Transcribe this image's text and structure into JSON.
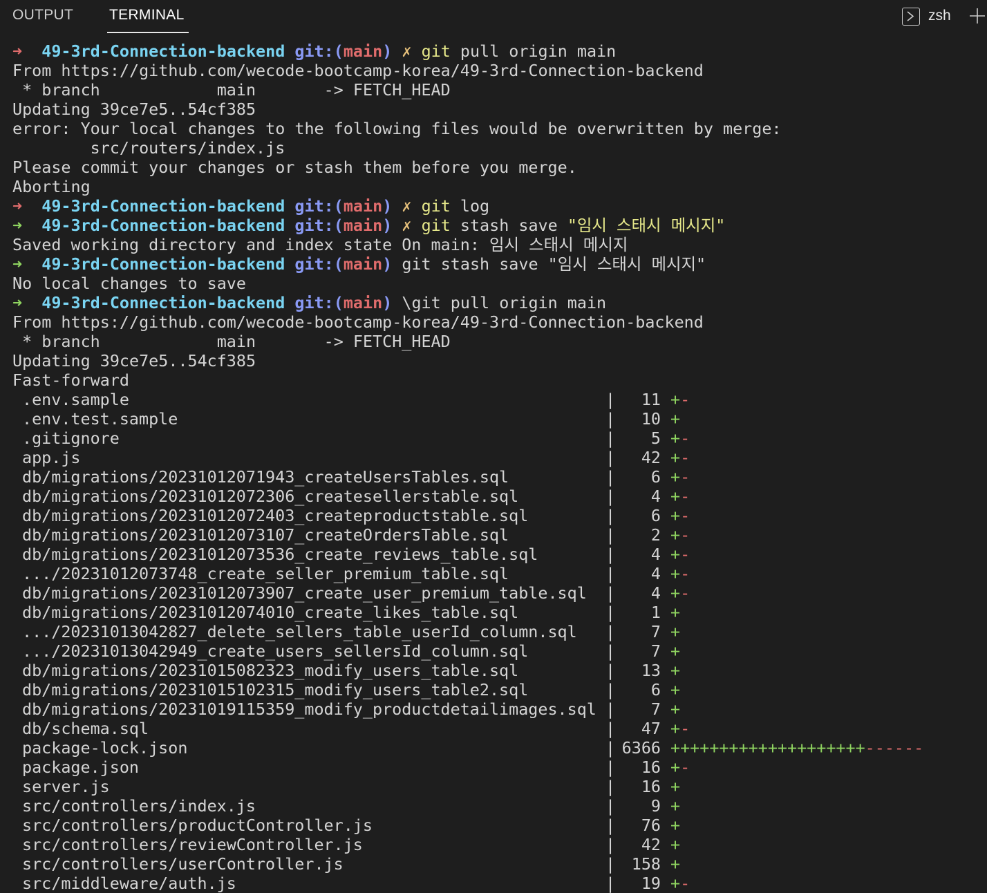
{
  "tabs": {
    "output": "OUTPUT",
    "terminal": "TERMINAL",
    "shell": "zsh"
  },
  "prompt": {
    "dir": "49-3rd-Connection-backend",
    "git": "git:",
    "branch": "main",
    "dirty": "✗"
  },
  "lines": [
    {
      "kind": "prompt",
      "arrow": "red",
      "dirty": true,
      "cmd_hl": "git",
      "cmd_rest": " pull origin main"
    },
    {
      "kind": "text",
      "text": "From https://github.com/wecode-bootcamp-korea/49-3rd-Connection-backend"
    },
    {
      "kind": "text",
      "text": " * branch            main       -> FETCH_HEAD"
    },
    {
      "kind": "text",
      "text": "Updating 39ce7e5..54cf385"
    },
    {
      "kind": "text",
      "text": "error: Your local changes to the following files would be overwritten by merge:"
    },
    {
      "kind": "text",
      "text": "        src/routers/index.js"
    },
    {
      "kind": "text",
      "text": "Please commit your changes or stash them before you merge."
    },
    {
      "kind": "text",
      "text": "Aborting"
    },
    {
      "kind": "prompt",
      "arrow": "red",
      "dirty": true,
      "cmd_hl": "git",
      "cmd_rest": " log"
    },
    {
      "kind": "prompt",
      "arrow": "green",
      "dirty": true,
      "cmd_hl": "git",
      "cmd_rest": " stash save ",
      "cmd_quote": "\"임시 스태시 메시지\""
    },
    {
      "kind": "text",
      "text": "Saved working directory and index state On main: 임시 스태시 메시지"
    },
    {
      "kind": "prompt",
      "arrow": "green",
      "dirty": false,
      "cmd_hl": "",
      "cmd_rest": "git stash save \"임시 스태시 메시지\""
    },
    {
      "kind": "text",
      "text": "No local changes to save"
    },
    {
      "kind": "prompt",
      "arrow": "green",
      "dirty": false,
      "cmd_hl": "",
      "cmd_rest": "\\git pull origin main"
    },
    {
      "kind": "text",
      "text": "From https://github.com/wecode-bootcamp-korea/49-3rd-Connection-backend"
    },
    {
      "kind": "text",
      "text": " * branch            main       -> FETCH_HEAD"
    },
    {
      "kind": "text",
      "text": "Updating 39ce7e5..54cf385"
    },
    {
      "kind": "text",
      "text": "Fast-forward"
    }
  ],
  "diffstat": [
    {
      "file": ".env.sample",
      "count": "11",
      "plus": "+",
      "minus": "-"
    },
    {
      "file": ".env.test.sample",
      "count": "10",
      "plus": "+",
      "minus": ""
    },
    {
      "file": ".gitignore",
      "count": "5",
      "plus": "+",
      "minus": "-"
    },
    {
      "file": "app.js",
      "count": "42",
      "plus": "+",
      "minus": "-"
    },
    {
      "file": "db/migrations/20231012071943_createUsersTables.sql",
      "count": "6",
      "plus": "+",
      "minus": "-"
    },
    {
      "file": "db/migrations/20231012072306_createsellerstable.sql",
      "count": "4",
      "plus": "+",
      "minus": "-"
    },
    {
      "file": "db/migrations/20231012072403_createproductstable.sql",
      "count": "6",
      "plus": "+",
      "minus": "-"
    },
    {
      "file": "db/migrations/20231012073107_createOrdersTable.sql",
      "count": "2",
      "plus": "+",
      "minus": "-"
    },
    {
      "file": "db/migrations/20231012073536_create_reviews_table.sql",
      "count": "4",
      "plus": "+",
      "minus": "-"
    },
    {
      "file": ".../20231012073748_create_seller_premium_table.sql",
      "count": "4",
      "plus": "+",
      "minus": "-"
    },
    {
      "file": "db/migrations/20231012073907_create_user_premium_table.sql",
      "count": "4",
      "plus": "+",
      "minus": "-"
    },
    {
      "file": "db/migrations/20231012074010_create_likes_table.sql",
      "count": "1",
      "plus": "+",
      "minus": ""
    },
    {
      "file": ".../20231013042827_delete_sellers_table_userId_column.sql",
      "count": "7",
      "plus": "+",
      "minus": ""
    },
    {
      "file": ".../20231013042949_create_users_sellersId_column.sql",
      "count": "7",
      "plus": "+",
      "minus": ""
    },
    {
      "file": "db/migrations/20231015082323_modify_users_table.sql",
      "count": "13",
      "plus": "+",
      "minus": ""
    },
    {
      "file": "db/migrations/20231015102315_modify_users_table2.sql",
      "count": "6",
      "plus": "+",
      "minus": ""
    },
    {
      "file": "db/migrations/20231019115359_modify_productdetailimages.sql",
      "count": "7",
      "plus": "+",
      "minus": ""
    },
    {
      "file": "db/schema.sql",
      "count": "47",
      "plus": "+",
      "minus": "-"
    },
    {
      "file": "package-lock.json",
      "count": "6366",
      "plus": "++++++++++++++++++++",
      "minus": "------"
    },
    {
      "file": "package.json",
      "count": "16",
      "plus": "+",
      "minus": "-"
    },
    {
      "file": "server.js",
      "count": "16",
      "plus": "+",
      "minus": ""
    },
    {
      "file": "src/controllers/index.js",
      "count": "9",
      "plus": "+",
      "minus": ""
    },
    {
      "file": "src/controllers/productController.js",
      "count": "76",
      "plus": "+",
      "minus": ""
    },
    {
      "file": "src/controllers/reviewController.js",
      "count": "42",
      "plus": "+",
      "minus": ""
    },
    {
      "file": "src/controllers/userController.js",
      "count": "158",
      "plus": "+",
      "minus": ""
    },
    {
      "file": "src/middleware/auth.js",
      "count": "19",
      "plus": "+",
      "minus": "-"
    }
  ],
  "colors": {
    "background": "#1e1e1e",
    "prompt_dir": "#7ad4f2",
    "git_label": "#8a9af5",
    "branch": "#e06c6c",
    "arrow_fail": "#e06c6c",
    "arrow_ok": "#8fd460",
    "plus": "#8fd460",
    "minus": "#e06c6c"
  }
}
